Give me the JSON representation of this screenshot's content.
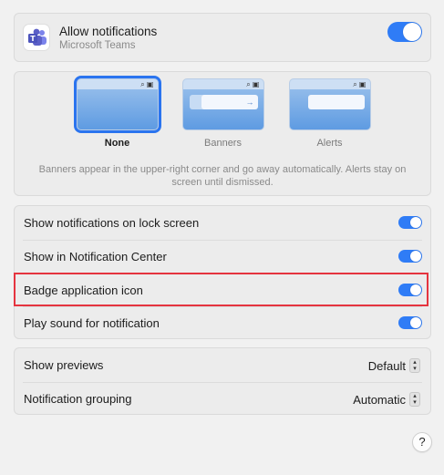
{
  "app": {
    "title": "Allow notifications",
    "subtitle": "Microsoft Teams",
    "allow_enabled": true
  },
  "alert_styles": {
    "options": [
      {
        "label": "None",
        "selected": true
      },
      {
        "label": "Banners",
        "selected": false
      },
      {
        "label": "Alerts",
        "selected": false
      }
    ],
    "description": "Banners appear in the upper-right corner and go away automatically. Alerts stay on screen until dismissed."
  },
  "toggles": [
    {
      "label": "Show notifications on lock screen",
      "on": true
    },
    {
      "label": "Show in Notification Center",
      "on": true
    },
    {
      "label": "Badge application icon",
      "on": true
    },
    {
      "label": "Play sound for notification",
      "on": true
    }
  ],
  "selects": [
    {
      "label": "Show previews",
      "value": "Default"
    },
    {
      "label": "Notification grouping",
      "value": "Automatic"
    }
  ],
  "help_label": "?",
  "colors": {
    "accent": "#2f7cf6",
    "highlight": "#e5343f",
    "teams_brand": "#5b5fc7"
  }
}
